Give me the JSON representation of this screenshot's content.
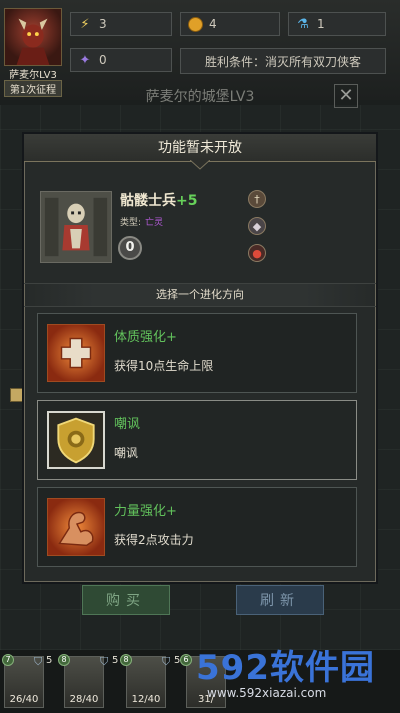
{
  "hero": {
    "name": "萨麦尔LV3",
    "run": "第1次征程"
  },
  "resources": {
    "energy": "3",
    "gold": "4",
    "potion": "1",
    "crystal": "0"
  },
  "victory": "胜利条件：消灭所有双刀侠客",
  "castle_title": "萨麦尔的城堡LV3",
  "close_label": "✕",
  "modal": {
    "title": "功能暂未开放",
    "unit": {
      "name": "骷髅士兵",
      "plus": "+5",
      "type_label": "类型:",
      "type_value": "亡灵",
      "level": "0"
    },
    "section_label": "选择一个进化方向",
    "options": [
      {
        "name": "体质强化+",
        "desc": "获得10点生命上限",
        "icon": "red-cross-icon"
      },
      {
        "name": "嘲讽",
        "desc": "嘲讽",
        "icon": "lion-shield-icon"
      },
      {
        "name": "力量强化+",
        "desc": "获得2点攻击力",
        "icon": "muscle-arm-icon"
      }
    ]
  },
  "buttons": {
    "buy": "购买",
    "refresh": "刷新"
  },
  "cards": [
    {
      "badge": "7",
      "shield": "5",
      "hp": "26/40"
    },
    {
      "badge": "8",
      "shield": "5",
      "hp": "28/40"
    },
    {
      "badge": "8",
      "shield": "5",
      "hp": "12/40"
    },
    {
      "badge": "6",
      "shield": "",
      "hp": "31/"
    }
  ],
  "watermark": {
    "main": "592软件园",
    "sub": "www.592xiazai.com"
  },
  "colors": {
    "accent_green": "#62c25c",
    "type_purple": "#b35ad8",
    "gold": "#c4a862"
  }
}
